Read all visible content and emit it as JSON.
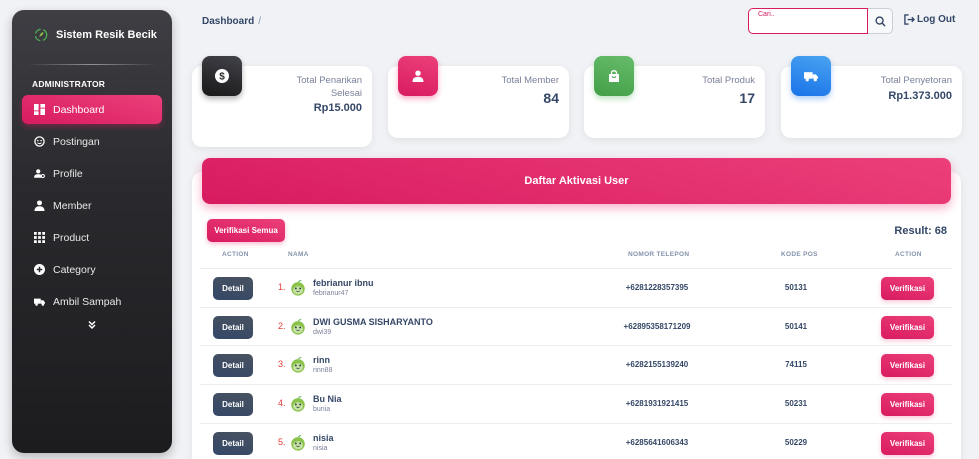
{
  "brand": {
    "name": "Sistem Resik Becik",
    "logo_icon": "recycle-leaf-icon"
  },
  "sidebar": {
    "heading": "ADMINISTRATOR",
    "items": [
      {
        "label": "Dashboard",
        "icon": "dashboard-icon",
        "active": true
      },
      {
        "label": "Postingan",
        "icon": "smiley-icon",
        "active": false
      },
      {
        "label": "Profile",
        "icon": "profile-icon",
        "active": false
      },
      {
        "label": "Member",
        "icon": "person-icon",
        "active": false
      },
      {
        "label": "Product",
        "icon": "grid-icon",
        "active": false
      },
      {
        "label": "Category",
        "icon": "add-circle-icon",
        "active": false
      },
      {
        "label": "Ambil Sampah",
        "icon": "truck-icon",
        "active": false
      }
    ],
    "more_icon": "double-chevron-down-icon"
  },
  "header": {
    "breadcrumb": "Dashboard",
    "breadcrumb_sep": "/",
    "search_label": "Cari..",
    "search_value": "",
    "logout_label": "Log Out"
  },
  "stats": [
    {
      "label": "Total Penarikan Selesai",
      "value": "Rp15.000",
      "icon": "dollar-icon",
      "color": "dark"
    },
    {
      "label": "Total Member",
      "value": "84",
      "icon": "person-icon",
      "color": "pink"
    },
    {
      "label": "Total Produk",
      "value": "17",
      "icon": "shopping-bag-icon",
      "color": "green"
    },
    {
      "label": "Total Penyetoran",
      "value": "Rp1.373.000",
      "icon": "truck-icon",
      "color": "blue"
    }
  ],
  "panel": {
    "title": "Daftar Aktivasi User",
    "verify_all_label": "Verifikasi Semua",
    "result_label": "Result: 68",
    "columns": [
      "ACTION",
      "NAMA",
      "NOMOR TELEPON",
      "KODE POS",
      "ACTION"
    ],
    "detail_label": "Detail",
    "verify_label": "Verifikasi",
    "rows": [
      {
        "no": "1.",
        "name": "febrianur ibnu",
        "username": "febrianur47",
        "phone": "+6281228357395",
        "kode_pos": "50131"
      },
      {
        "no": "2.",
        "name": "DWI GUSMA SISHARYANTO",
        "username": "dwi39",
        "phone": "+62895358171209",
        "kode_pos": "50141"
      },
      {
        "no": "3.",
        "name": "rinn",
        "username": "rinn88",
        "phone": "+6282155139240",
        "kode_pos": "74115"
      },
      {
        "no": "4.",
        "name": "Bu Nia",
        "username": "bunia",
        "phone": "+6281931921415",
        "kode_pos": "50231"
      },
      {
        "no": "5.",
        "name": "nisia",
        "username": "nisia",
        "phone": "+6285641606343",
        "kode_pos": "50229"
      }
    ]
  },
  "colors": {
    "accent": "#d81b60",
    "dark": "#344767",
    "green": "#43a047",
    "blue": "#1a73e8"
  }
}
